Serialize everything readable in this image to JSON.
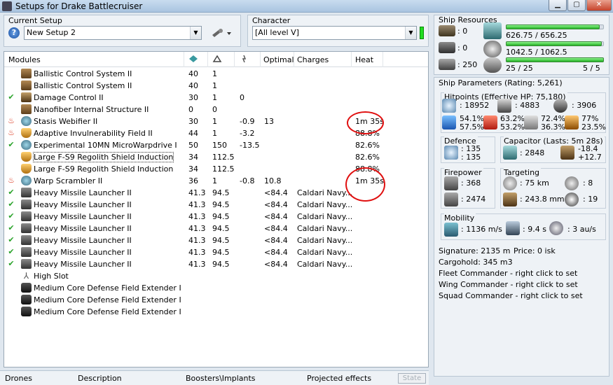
{
  "window": {
    "title": "Setups for Drake Battlecruiser",
    "btn_min": "▁",
    "btn_max": "▢",
    "btn_close": "✕"
  },
  "setup": {
    "label": "Current Setup",
    "help": "?",
    "value": "New Setup 2",
    "arrow": "▼"
  },
  "character": {
    "label": "Character",
    "value": "[All level V]",
    "arrow": "▼"
  },
  "modules": {
    "headers": {
      "name": "Modules",
      "optimal": "Optimal",
      "charges": "Charges",
      "heat": "Heat"
    },
    "rows": [
      {
        "state": "",
        "icon": "cpu",
        "name": "Ballistic Control System II",
        "c1": "40",
        "c2": "1",
        "c3": "",
        "opt": "",
        "charge": "",
        "heat": ""
      },
      {
        "state": "",
        "icon": "cpu",
        "name": "Ballistic Control System II",
        "c1": "40",
        "c2": "1",
        "c3": "",
        "opt": "",
        "charge": "",
        "heat": ""
      },
      {
        "state": "✔",
        "icon": "low",
        "name": "Damage Control II",
        "c1": "30",
        "c2": "1",
        "c3": "0",
        "opt": "",
        "charge": "",
        "heat": ""
      },
      {
        "state": "",
        "icon": "cpu",
        "name": "Nanofiber Internal Structure II",
        "c1": "0",
        "c2": "0",
        "c3": "",
        "opt": "",
        "charge": "",
        "heat": ""
      },
      {
        "state": "♨",
        "icon": "mid",
        "name": "Stasis Webifier II",
        "c1": "30",
        "c2": "1",
        "c3": "-0.9",
        "opt": "13",
        "charge": "",
        "heat": "1m 35s"
      },
      {
        "state": "♨",
        "icon": "shield",
        "name": "Adaptive Invulnerability Field II",
        "c1": "44",
        "c2": "1",
        "c3": "-3.2",
        "opt": "",
        "charge": "",
        "heat": "88.8%"
      },
      {
        "state": "✔",
        "icon": "mid",
        "name": "Experimental 10MN MicroWarpdrive I",
        "c1": "50",
        "c2": "150",
        "c3": "-13.5",
        "opt": "",
        "charge": "",
        "heat": "82.6%"
      },
      {
        "state": "",
        "icon": "shield",
        "name": "Large F-S9 Regolith Shield Induction",
        "c1": "34",
        "c2": "112.5",
        "c3": "",
        "opt": "",
        "charge": "",
        "heat": "82.6%"
      },
      {
        "state": "",
        "icon": "shield",
        "name": "Large F-S9 Regolith Shield Induction",
        "c1": "34",
        "c2": "112.5",
        "c3": "",
        "opt": "",
        "charge": "",
        "heat": "88.8%"
      },
      {
        "state": "♨",
        "icon": "mid",
        "name": "Warp Scrambler II",
        "c1": "36",
        "c2": "1",
        "c3": "-0.8",
        "opt": "10.8",
        "charge": "",
        "heat": "1m 35s"
      },
      {
        "state": "✔",
        "icon": "launch",
        "name": "Heavy Missile Launcher II",
        "c1": "41.3",
        "c2": "94.5",
        "c3": "",
        "opt": "<84.4",
        "charge": "Caldari Navy...",
        "heat": ""
      },
      {
        "state": "✔",
        "icon": "launch",
        "name": "Heavy Missile Launcher II",
        "c1": "41.3",
        "c2": "94.5",
        "c3": "",
        "opt": "<84.4",
        "charge": "Caldari Navy...",
        "heat": ""
      },
      {
        "state": "✔",
        "icon": "launch",
        "name": "Heavy Missile Launcher II",
        "c1": "41.3",
        "c2": "94.5",
        "c3": "",
        "opt": "<84.4",
        "charge": "Caldari Navy...",
        "heat": ""
      },
      {
        "state": "✔",
        "icon": "launch",
        "name": "Heavy Missile Launcher II",
        "c1": "41.3",
        "c2": "94.5",
        "c3": "",
        "opt": "<84.4",
        "charge": "Caldari Navy...",
        "heat": ""
      },
      {
        "state": "✔",
        "icon": "launch",
        "name": "Heavy Missile Launcher II",
        "c1": "41.3",
        "c2": "94.5",
        "c3": "",
        "opt": "<84.4",
        "charge": "Caldari Navy...",
        "heat": ""
      },
      {
        "state": "✔",
        "icon": "launch",
        "name": "Heavy Missile Launcher II",
        "c1": "41.3",
        "c2": "94.5",
        "c3": "",
        "opt": "<84.4",
        "charge": "Caldari Navy...",
        "heat": ""
      },
      {
        "state": "✔",
        "icon": "launch",
        "name": "Heavy Missile Launcher II",
        "c1": "41.3",
        "c2": "94.5",
        "c3": "",
        "opt": "<84.4",
        "charge": "Caldari Navy...",
        "heat": ""
      },
      {
        "state": "",
        "icon": "hi",
        "name": "High Slot",
        "c1": "",
        "c2": "",
        "c3": "",
        "opt": "",
        "charge": "",
        "heat": ""
      },
      {
        "state": "",
        "icon": "dark",
        "name": "Medium Core Defense Field Extender I",
        "c1": "",
        "c2": "",
        "c3": "",
        "opt": "",
        "charge": "",
        "heat": ""
      },
      {
        "state": "",
        "icon": "dark",
        "name": "Medium Core Defense Field Extender I",
        "c1": "",
        "c2": "",
        "c3": "",
        "opt": "",
        "charge": "",
        "heat": ""
      },
      {
        "state": "",
        "icon": "dark",
        "name": "Medium Core Defense Field Extender I",
        "c1": "",
        "c2": "",
        "c3": "",
        "opt": "",
        "charge": "",
        "heat": ""
      }
    ]
  },
  "tabs": {
    "drones": "Drones",
    "description": "Description",
    "boosters": "Boosters\\Implants",
    "projected": "Projected effects",
    "state": "State"
  },
  "resources": {
    "label": "Ship Resources",
    "turrets": ": 0",
    "launchers": ": 0",
    "drone_bay": ": 250",
    "cpu": "626.75 / 656.25",
    "cpu_fill": 0.955,
    "power": "1042.5 / 1062.5",
    "power_fill": 0.981,
    "calibration": "25 / 25",
    "calibration_fill": 1.0,
    "slots": "5 / 5"
  },
  "params": {
    "label": "Ship Parameters (Rating: 5,261)",
    "hitpoints": {
      "label": "Hitpoints (Effective HP: 75,180)",
      "shield": ": 18952",
      "armor": ": 4883",
      "structure": ": 3906",
      "res_em": [
        "54.1%",
        "57.5%"
      ],
      "res_th": [
        "63.2%",
        "53.2%"
      ],
      "res_ki": [
        "72.4%",
        "36.3%"
      ],
      "res_ex": [
        "77%",
        "23.5%"
      ]
    },
    "defence": {
      "label": "Defence",
      "a": ": 135",
      "b": ": 135"
    },
    "capacitor": {
      "label": "Capacitor (Lasts: 5m 28s)",
      "amount": ": 2848",
      "delta_a": "-18.4",
      "delta_b": "+12.7"
    },
    "firepower": {
      "label": "Firepower",
      "a": ": 368",
      "b": ": 2474"
    },
    "targeting": {
      "label": "Targeting",
      "range": ": 75 km",
      "targets": ": 8",
      "scan": ": 243.8 mm",
      "sensor": ": 19"
    },
    "mobility": {
      "label": "Mobility",
      "speed": ": 1136 m/s",
      "align": ": 9.4 s",
      "warp": ": 3 au/s"
    },
    "signature": "Signature: 2135 m",
    "price": "Price: 0 isk",
    "cargo": "Cargohold: 345 m3",
    "fleet": "Fleet Commander - right click to set",
    "wing": "Wing Commander - right click to set",
    "squad": "Squad Commander - right click to set"
  },
  "colors": {
    "accent": "#22dd22",
    "annotation": "#e01010"
  }
}
